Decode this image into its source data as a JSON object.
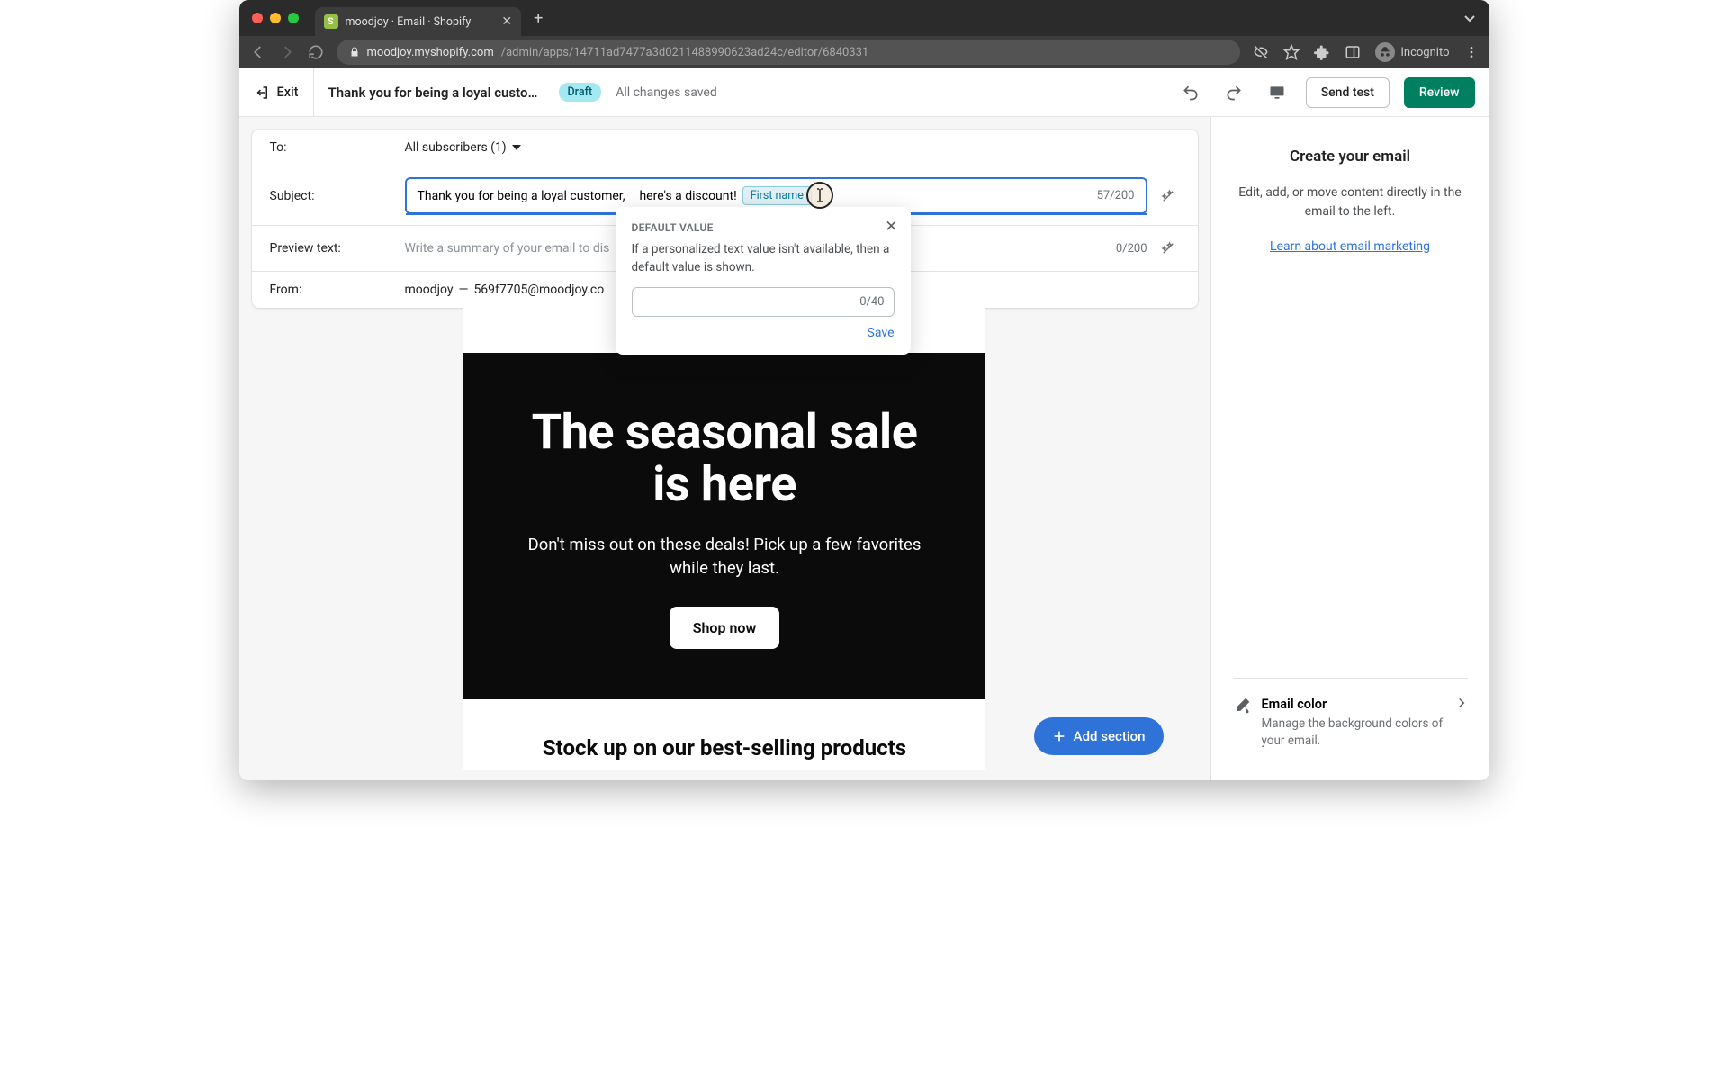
{
  "browser": {
    "tab_title": "moodjoy · Email · Shopify",
    "url_host": "moodjoy.myshopify.com",
    "url_path": "/admin/apps/14711ad7477a3d0211488990623ad24c/editor/6840331",
    "incognito_label": "Incognito"
  },
  "header": {
    "exit_label": "Exit",
    "page_title": "Thank you for being a loyal custom…",
    "draft_badge": "Draft",
    "saved_label": "All changes saved",
    "send_test_label": "Send test",
    "review_label": "Review"
  },
  "editor": {
    "to_label": "To:",
    "to_value": "All subscribers (1)",
    "subject_label": "Subject:",
    "subject_text_prefix": "Thank you for being a loyal customer,",
    "subject_text_suffix": "here's a discount!",
    "subject_variable": "First name",
    "subject_counter": "57/200",
    "preview_label": "Preview text:",
    "preview_placeholder": "Write a summary of your email to dis",
    "preview_counter": "0/200",
    "from_label": "From:",
    "from_name": "moodjoy",
    "from_sep": "—",
    "from_email": "569f7705@moodjoy.co"
  },
  "popover": {
    "title": "DEFAULT VALUE",
    "description": "If a personalized text value isn't available, then a default value is shown.",
    "input_counter": "0/40",
    "save_label": "Save"
  },
  "email_preview": {
    "hero_title": "The seasonal sale is here",
    "hero_subtitle": "Don't miss out on these deals! Pick up a few favorites while they last.",
    "cta_label": "Shop now",
    "stock_title": "Stock up on our best-selling products"
  },
  "add_section_label": "Add section",
  "right_panel": {
    "title": "Create your email",
    "description": "Edit, add, or move content directly in the email to the left.",
    "link_label": "Learn about email marketing",
    "email_color_title": "Email color",
    "email_color_desc": "Manage the background colors of your email."
  }
}
